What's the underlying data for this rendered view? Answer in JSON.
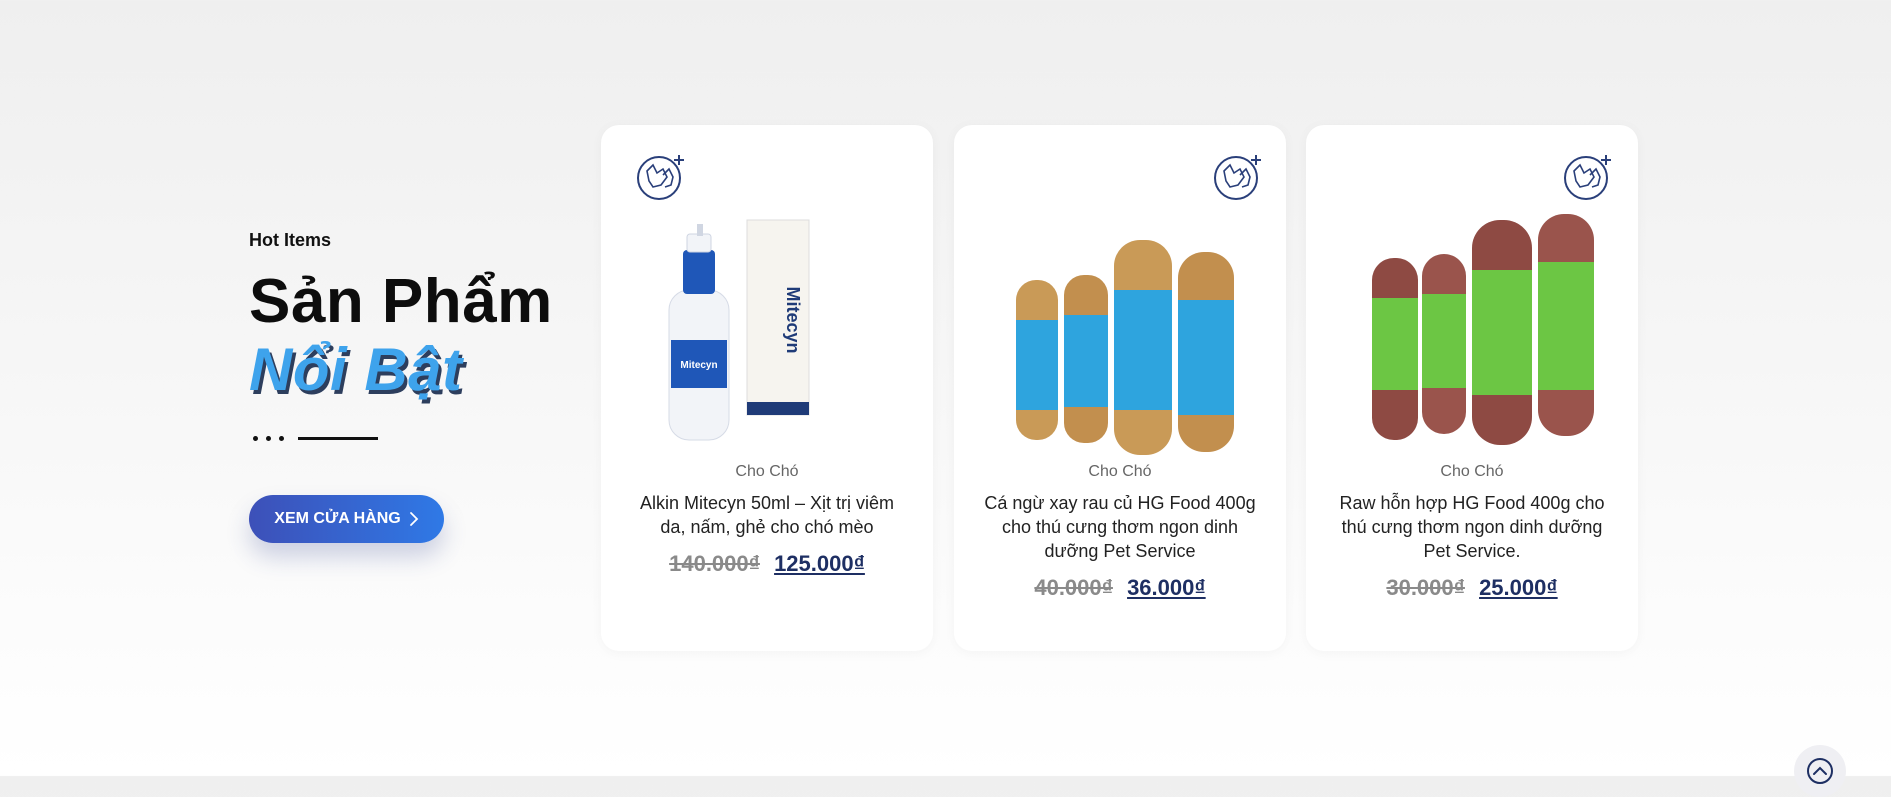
{
  "section": {
    "eyebrow": "Hot Items",
    "title_line1": "Sản Phẩm",
    "title_line2": "Nổi Bật",
    "shop_button": "XEM CỬA HÀNG"
  },
  "products": [
    {
      "category": "Cho Chó",
      "name": "Alkin Mitecyn 50ml – Xịt trị viêm da, nấm, ghẻ cho chó mèo",
      "old_price": "140.000₫",
      "new_price": "125.000₫",
      "image_icon": "spray-bottle-and-box-image"
    },
    {
      "category": "Cho Chó",
      "name": "Cá ngừ xay rau củ HG Food 400g cho thú cưng thơm ngon dinh dưỡng Pet Service",
      "old_price": "40.000₫",
      "new_price": "36.000₫",
      "image_icon": "tuna-sausage-rolls-image"
    },
    {
      "category": "Cho Chó",
      "name": "Raw hỗn hợp HG Food 400g cho thú cưng thơm ngon dinh dưỡng Pet Service.",
      "old_price": "30.000₫",
      "new_price": "25.000₫",
      "image_icon": "raw-mixed-rolls-image"
    }
  ],
  "colors": {
    "accent_blue": "#3ea3ec",
    "price_navy": "#1e2f63",
    "button_gradient_start": "#3d50b8",
    "button_gradient_end": "#2f79e6",
    "tuna_label": "#2ea4de",
    "raw_label": "#6cc644"
  }
}
